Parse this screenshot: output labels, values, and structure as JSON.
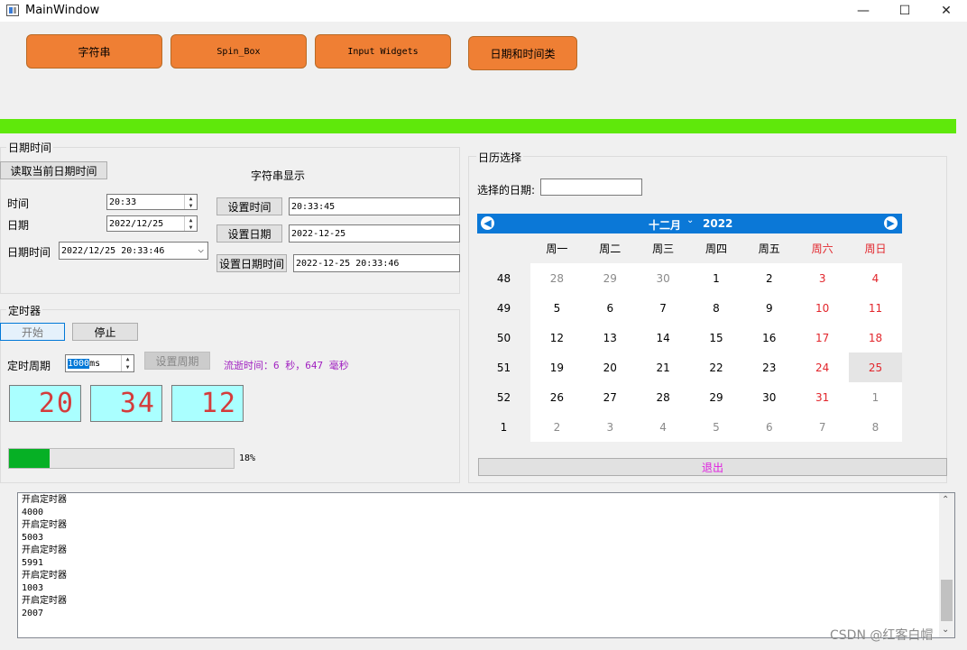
{
  "window": {
    "title": "MainWindow",
    "minimize": "—",
    "maximize": "☐",
    "close": "✕"
  },
  "top_buttons": [
    "字符串",
    "Spin_Box",
    "Input Widgets",
    "日期和时间类"
  ],
  "datetime_group": {
    "title": "日期时间",
    "read_button": "读取当前日期时间",
    "string_display_label": "字符串显示",
    "time_label": "时间",
    "time_value": "20:33",
    "date_label": "日期",
    "date_value": "2022/12/25",
    "datetime_label": "日期时间",
    "datetime_value": "2022/12/25 20:33:46",
    "set_time_button": "设置时间",
    "set_time_value": "20:33:45",
    "set_date_button": "设置日期",
    "set_date_value": "2022-12-25",
    "set_datetime_button": "设置日期时间",
    "set_datetime_value": "2022-12-25 20:33:46"
  },
  "timer_group": {
    "title": "定时器",
    "start_button": "开始",
    "stop_button": "停止",
    "period_label": "定时周期",
    "period_value": "1000",
    "period_unit": " ms",
    "set_period_button": "设置周期",
    "elapsed_text": "流逝时间：6 秒，647 毫秒",
    "lcd_hour": "20",
    "lcd_minute": "34",
    "lcd_second": "12",
    "progress_percent": 18,
    "progress_text": "18%"
  },
  "calendar_group": {
    "title": "日历选择",
    "selected_label": "选择的日期:",
    "selected_value": "",
    "month": "十二月",
    "year": "2022",
    "weekdays": [
      "周一",
      "周二",
      "周三",
      "周四",
      "周五",
      "周六",
      "周日"
    ],
    "weeks": [
      {
        "num": "48",
        "days": [
          "28",
          "29",
          "30",
          "1",
          "2",
          "3",
          "4"
        ]
      },
      {
        "num": "49",
        "days": [
          "5",
          "6",
          "7",
          "8",
          "9",
          "10",
          "11"
        ]
      },
      {
        "num": "50",
        "days": [
          "12",
          "13",
          "14",
          "15",
          "16",
          "17",
          "18"
        ]
      },
      {
        "num": "51",
        "days": [
          "19",
          "20",
          "21",
          "22",
          "23",
          "24",
          "25"
        ]
      },
      {
        "num": "52",
        "days": [
          "26",
          "27",
          "28",
          "29",
          "30",
          "31",
          "1"
        ]
      },
      {
        "num": "1",
        "days": [
          "2",
          "3",
          "4",
          "5",
          "6",
          "7",
          "8"
        ]
      }
    ],
    "selected_day": "25",
    "exit_button": "退出",
    "colors": {
      "nav": "#0b78d7",
      "weekend": "#e2262c",
      "exit_text": "#e020e0"
    }
  },
  "log": {
    "lines": [
      "开启定时器",
      "4000",
      "开启定时器",
      "5003",
      "开启定时器",
      "5991",
      "开启定时器",
      "1003",
      "开启定时器",
      "2007"
    ]
  },
  "watermark": "CSDN @红客白帽"
}
